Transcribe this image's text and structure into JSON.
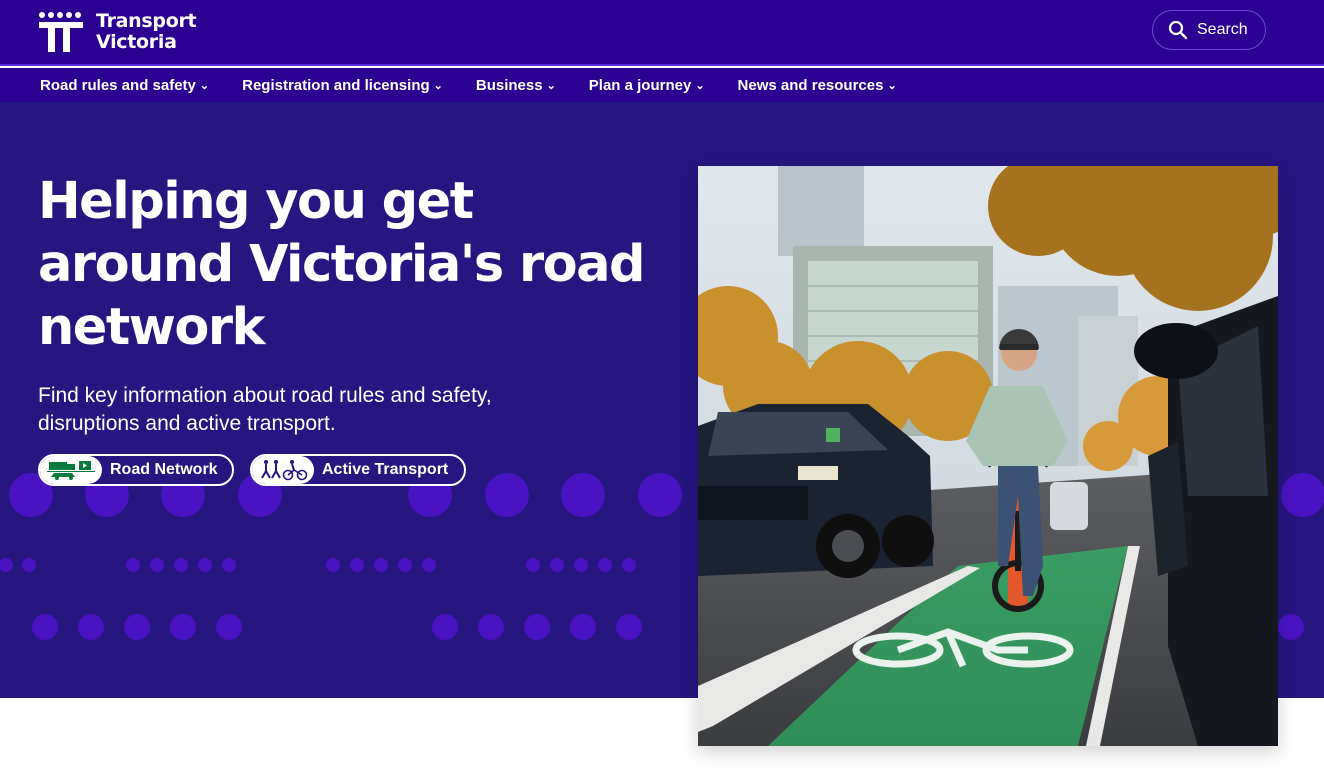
{
  "header": {
    "logo_line1": "Transport",
    "logo_line2": "Victoria",
    "search_label": "Search"
  },
  "nav": {
    "items": [
      {
        "label": "Road rules and safety"
      },
      {
        "label": "Registration and licensing"
      },
      {
        "label": "Business"
      },
      {
        "label": "Plan a journey"
      },
      {
        "label": "News and resources"
      }
    ]
  },
  "hero": {
    "title": "Helping you get around Victoria's road network",
    "subtitle": "Find key information about road rules and safety, disruptions and active transport.",
    "buttons": [
      {
        "label": "Road Network",
        "icon": "car-truck-icon"
      },
      {
        "label": "Active Transport",
        "icon": "walk-cycle-icon"
      }
    ],
    "image_icon": "cyclist-bike-lane-photo"
  },
  "colors": {
    "header_bg": "#2c0090",
    "hero_bg": "#271580",
    "dot_color": "#4a13c2",
    "bike_lane_green": "#2f9a5e"
  }
}
